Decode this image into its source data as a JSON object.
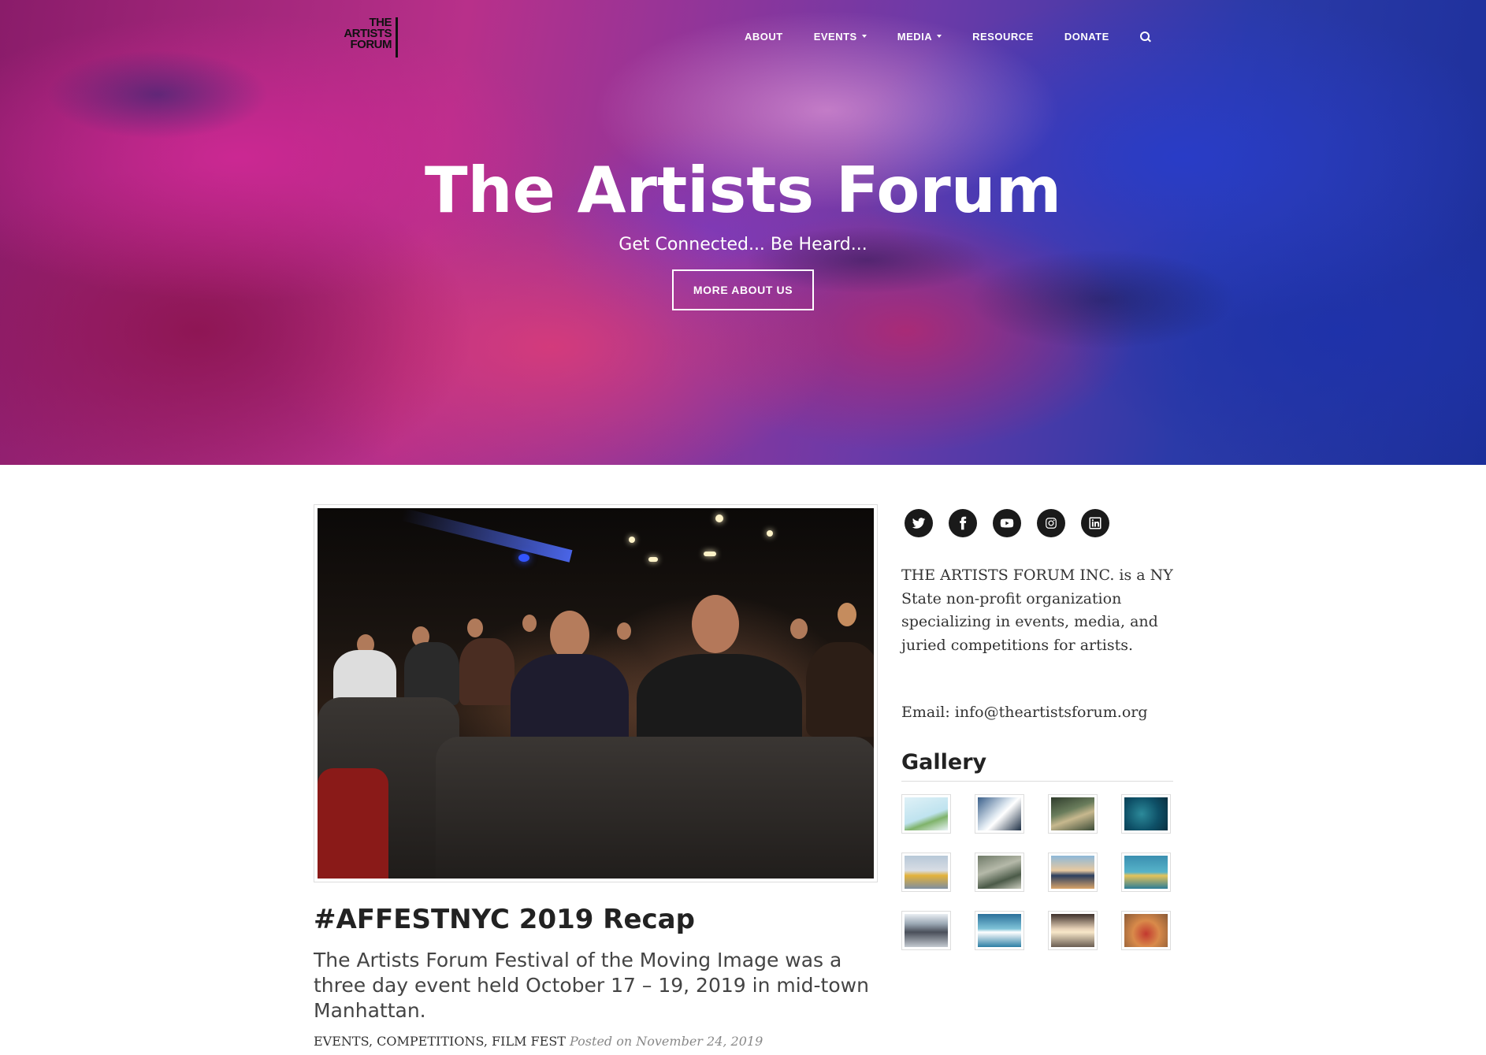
{
  "site": {
    "logo_lines": [
      "THE",
      "ARTISTS",
      "FORUM"
    ]
  },
  "nav": {
    "about": "ABOUT",
    "events": "EVENTS",
    "media": "MEDIA",
    "resource": "RESOURCE",
    "donate": "DONATE",
    "search_icon": "search-icon"
  },
  "hero": {
    "title": "The Artists Forum",
    "tagline": "Get Connected... Be Heard...",
    "button": "MORE ABOUT US"
  },
  "post": {
    "title": "#AFFESTNYC 2019 Recap",
    "excerpt": "The Artists Forum Festival of the Moving Image was a three day event held October 17 – 19, 2019 in mid-town Manhattan.",
    "categories": [
      "EVENTS",
      "COMPETITIONS",
      "FILM FEST"
    ],
    "posted_on": "Posted on November 24, 2019"
  },
  "sidebar": {
    "social": [
      "twitter-icon",
      "facebook-icon",
      "youtube-icon",
      "instagram-icon",
      "linkedin-icon"
    ],
    "about": "THE ARTISTS FORUM INC. is a NY State non-profit organization specializing in events, media, and juried competitions for artists.",
    "email": "Email: info@theartistsforum.org",
    "gallery_heading": "Gallery",
    "gallery_count": 12
  },
  "colors": {
    "hero_magenta": "#b8308a",
    "hero_blue": "#1c2f9a",
    "text_dark": "#222222",
    "social_bg": "#1a1a1a"
  }
}
